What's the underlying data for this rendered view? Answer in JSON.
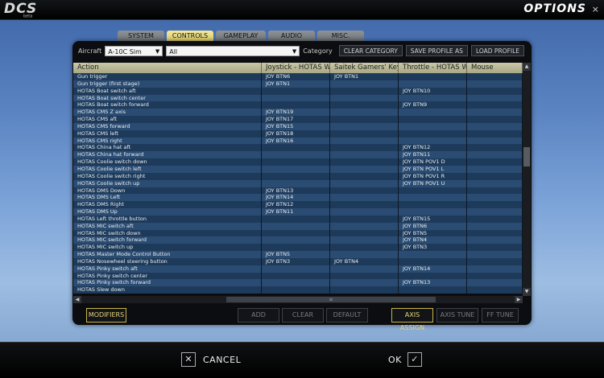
{
  "app": {
    "logo_text": "DCS",
    "logo_sub": "beta",
    "title": "OPTIONS",
    "close": "×"
  },
  "tabs": [
    {
      "label": "SYSTEM"
    },
    {
      "label": "CONTROLS"
    },
    {
      "label": "GAMEPLAY"
    },
    {
      "label": "AUDIO"
    },
    {
      "label": "MISC."
    }
  ],
  "filter": {
    "aircraft_label": "Aircraft",
    "aircraft_value": "A-10C Sim",
    "category_value": "All",
    "category_label": "Category",
    "buttons": [
      "CLEAR CATEGORY",
      "SAVE PROFILE AS",
      "LOAD PROFILE"
    ]
  },
  "columns": [
    "Action",
    "Joystick - HOTAS Warthog",
    "Saitek Gamers' Keyboard",
    "Throttle - HOTAS Warthog",
    "Mouse"
  ],
  "rows": [
    [
      "Gun trigger",
      "JOY BTN6",
      "JOY BTN1",
      "",
      ""
    ],
    [
      "Gun trigger (first stage)",
      "JOY BTN1",
      "",
      "",
      ""
    ],
    [
      "HOTAS Boat switch aft",
      "",
      "",
      "JOY BTN10",
      ""
    ],
    [
      "HOTAS Boat switch center",
      "",
      "",
      "",
      ""
    ],
    [
      "HOTAS Boat switch forward",
      "",
      "",
      "JOY BTN9",
      ""
    ],
    [
      "HOTAS CMS Z axis",
      "JOY BTN19",
      "",
      "",
      ""
    ],
    [
      "HOTAS CMS aft",
      "JOY BTN17",
      "",
      "",
      ""
    ],
    [
      "HOTAS CMS forward",
      "JOY BTN15",
      "",
      "",
      ""
    ],
    [
      "HOTAS CMS left",
      "JOY BTN18",
      "",
      "",
      ""
    ],
    [
      "HOTAS CMS right",
      "JOY BTN16",
      "",
      "",
      ""
    ],
    [
      "HOTAS China hat aft",
      "",
      "",
      "JOY BTN12",
      ""
    ],
    [
      "HOTAS China hat forward",
      "",
      "",
      "JOY BTN11",
      ""
    ],
    [
      "HOTAS Coolie switch down",
      "",
      "",
      "JOY BTN POV1 D",
      ""
    ],
    [
      "HOTAS Coolie switch left",
      "",
      "",
      "JOY BTN POV1 L",
      ""
    ],
    [
      "HOTAS Coolie switch right",
      "",
      "",
      "JOY BTN POV1 R",
      ""
    ],
    [
      "HOTAS Coolie switch up",
      "",
      "",
      "JOY BTN POV1 U",
      ""
    ],
    [
      "HOTAS DMS Down",
      "JOY BTN13",
      "",
      "",
      ""
    ],
    [
      "HOTAS DMS Left",
      "JOY BTN14",
      "",
      "",
      ""
    ],
    [
      "HOTAS DMS Right",
      "JOY BTN12",
      "",
      "",
      ""
    ],
    [
      "HOTAS DMS Up",
      "JOY BTN11",
      "",
      "",
      ""
    ],
    [
      "HOTAS Left throttle button",
      "",
      "",
      "JOY BTN15",
      ""
    ],
    [
      "HOTAS MIC switch aft",
      "",
      "",
      "JOY BTN6",
      ""
    ],
    [
      "HOTAS MIC switch down",
      "",
      "",
      "JOY BTN5",
      ""
    ],
    [
      "HOTAS MIC switch forward",
      "",
      "",
      "JOY BTN4",
      ""
    ],
    [
      "HOTAS MIC switch up",
      "",
      "",
      "JOY BTN3",
      ""
    ],
    [
      "HOTAS Master Mode Control Button",
      "JOY BTN5",
      "",
      "",
      ""
    ],
    [
      "HOTAS Nosewheel steering button",
      "JOY BTN3",
      "JOY BTN4",
      "",
      ""
    ],
    [
      "HOTAS Pinky switch aft",
      "",
      "",
      "JOY BTN14",
      ""
    ],
    [
      "HOTAS Pinky switch center",
      "",
      "",
      "",
      ""
    ],
    [
      "HOTAS Pinky switch forward",
      "",
      "",
      "JOY BTN13",
      ""
    ],
    [
      "HOTAS Slew down",
      "",
      "",
      "",
      ""
    ]
  ],
  "scroll": {
    "up": "▲",
    "down": "▼",
    "left": "◀",
    "right": "▶",
    "grip": "≡"
  },
  "actions": {
    "modifiers": "MODIFIERS",
    "add": "ADD",
    "clear": "CLEAR",
    "default": "DEFAULT",
    "axis_assign": "AXIS ASSIGN",
    "axis_tune": "AXIS TUNE",
    "ff_tune": "FF TUNE"
  },
  "footer": {
    "cancel": "CANCEL",
    "cancel_icon": "✕",
    "ok": "OK",
    "ok_icon": "✓"
  }
}
